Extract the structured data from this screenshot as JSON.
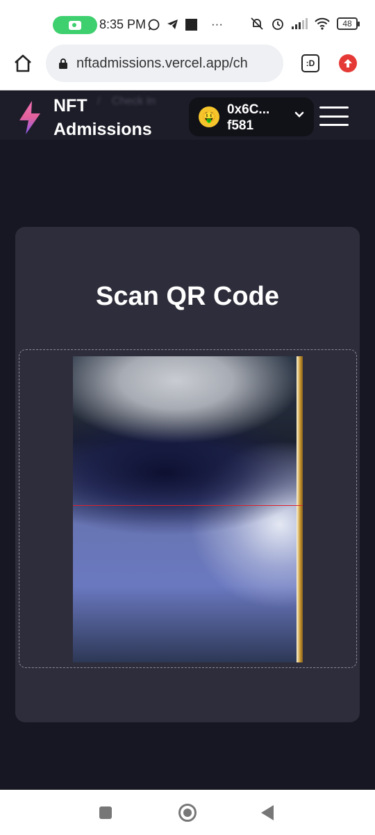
{
  "status_bar": {
    "time": "8:35 PM",
    "battery": "48",
    "more": "···",
    "icons": [
      "camera-recording-icon",
      "whatsapp-icon",
      "telegram-icon",
      "notification-square-icon",
      "muted-icon",
      "alarm-icon",
      "signal-icon",
      "wifi-icon",
      "battery-icon"
    ]
  },
  "browser": {
    "url": "nftadmissions.vercel.app/ch",
    "tabs_label": ":D",
    "icons": [
      "home-icon",
      "lock-icon",
      "tabs-icon",
      "update-icon"
    ]
  },
  "header": {
    "brand_line1": "NFT",
    "brand_line2": "Admissions",
    "breadcrumb_separator": "/",
    "breadcrumb_current": "Check In",
    "wallet_line1": "0x6C...",
    "wallet_line2": "f581",
    "wallet_avatar_emoji": "🤑",
    "icons": [
      "logo-bolt-icon",
      "chevron-down-icon",
      "hamburger-menu-icon"
    ]
  },
  "scanner": {
    "title": "Scan QR Code"
  },
  "nav_bar": {
    "icons": [
      "recents-icon",
      "home-circle-icon",
      "back-icon"
    ]
  },
  "colors": {
    "background": "#171723",
    "header": "#1d1d29",
    "card": "#2e2d3b",
    "wallet": "#111118",
    "scan_line": "#e0202a",
    "accent_pill": "#3ecf6e",
    "update_badge": "#e53935"
  }
}
